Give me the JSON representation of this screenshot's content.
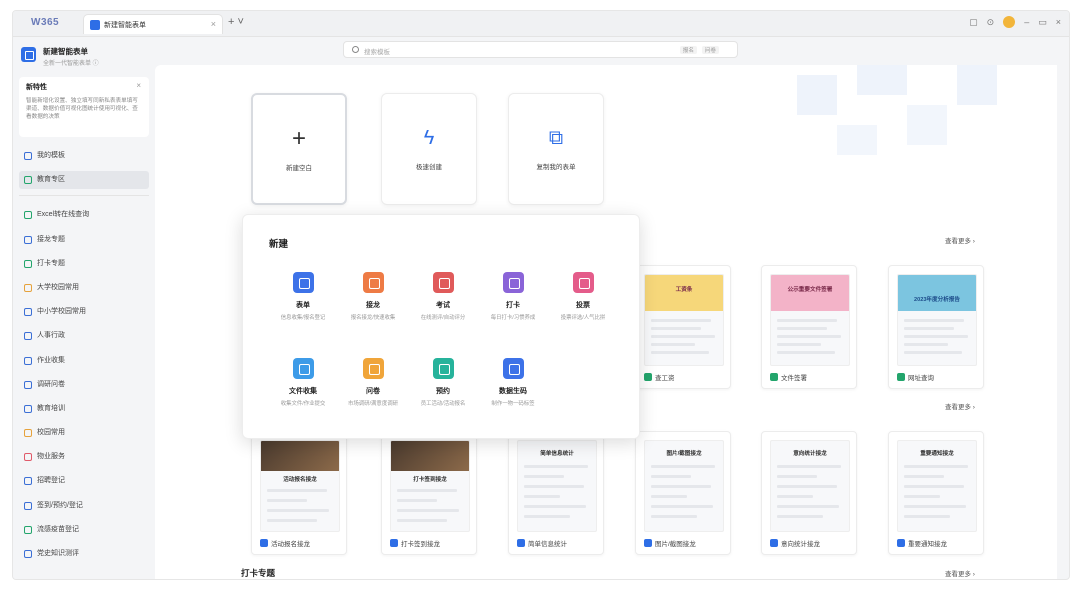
{
  "tabbar": {
    "brand": "W365",
    "tab_title": "新建智能表单",
    "tab_close": "×",
    "new_tab": "+ ˅",
    "controls": [
      "▢",
      "⊙",
      "–",
      "▭",
      "×"
    ]
  },
  "sidebar": {
    "app_title": "新建智能表单",
    "app_subtitle": "全新一代智能表单 ⓘ",
    "tip_title": "新特性",
    "tip_close": "×",
    "tip_body": "智能新增化设置、独立填写同新私表表单填写渠道、数据价值可视化图统计使用可视化、查看数据的决策",
    "items": [
      {
        "label": "我的模板",
        "color": "blue",
        "active": false
      },
      {
        "label": "教育专区",
        "color": "green",
        "active": true
      },
      {
        "label": "Excel转在线查询",
        "color": "green",
        "active": false
      },
      {
        "label": "接龙专题",
        "color": "blue",
        "active": false
      },
      {
        "label": "打卡专题",
        "color": "green",
        "active": false
      },
      {
        "label": "大学校园常用",
        "color": "orange",
        "active": false
      },
      {
        "label": "中小学校园常用",
        "color": "blue",
        "active": false
      },
      {
        "label": "人事行政",
        "color": "blue",
        "active": false
      },
      {
        "label": "作业收集",
        "color": "blue",
        "active": false
      },
      {
        "label": "调研问卷",
        "color": "blue",
        "active": false
      },
      {
        "label": "教育培训",
        "color": "blue",
        "active": false
      },
      {
        "label": "校园常用",
        "color": "orange",
        "active": false
      },
      {
        "label": "物业服务",
        "color": "red",
        "active": false
      },
      {
        "label": "招聘登记",
        "color": "blue",
        "active": false
      },
      {
        "label": "签到/预约/登记",
        "color": "blue",
        "active": false
      },
      {
        "label": "流感疫苗登记",
        "color": "green",
        "active": false
      },
      {
        "label": "党史知识测评",
        "color": "blue",
        "active": false
      }
    ]
  },
  "search": {
    "placeholder": "搜索模板",
    "tag1": "报名",
    "tag2": "问卷"
  },
  "create_cards": [
    {
      "label": "新建空白",
      "icon": "plus-icon",
      "glyph": "+"
    },
    {
      "label": "极速创建",
      "icon": "lightning-icon",
      "glyph": "ϟ"
    },
    {
      "label": "复制我的表单",
      "icon": "copy-icon",
      "glyph": "⧉"
    }
  ],
  "popup": {
    "title": "新建",
    "items": [
      {
        "label": "表单",
        "desc": "信息收集/报名登记",
        "color": "#3d72e8"
      },
      {
        "label": "接龙",
        "desc": "报名接龙/快速收集",
        "color": "#ee7b45"
      },
      {
        "label": "考试",
        "desc": "在线测评/自动评分",
        "color": "#e05a5a"
      },
      {
        "label": "打卡",
        "desc": "每日打卡/习惯养成",
        "color": "#8a64d8"
      },
      {
        "label": "投票",
        "desc": "投票评选/人气比拼",
        "color": "#e45c8a"
      },
      {
        "label": "文件收集",
        "desc": "收集文件/作业提交",
        "color": "#3d9be8"
      },
      {
        "label": "问卷",
        "desc": "市场调研/满意度调研",
        "color": "#f0a53a"
      },
      {
        "label": "预约",
        "desc": "员工活动/活动报名",
        "color": "#26b39b"
      },
      {
        "label": "数据生码",
        "desc": "制作一物一码标签",
        "color": "#3d72e8"
      }
    ]
  },
  "row1": {
    "more": "查看更多 ›",
    "templates": [
      {
        "label": "查工资",
        "header": "工资条",
        "header_color": "#f6d77a"
      },
      {
        "label": "文件签署",
        "header": "公示重要文件签署",
        "header_color": "#f3b3c8"
      },
      {
        "label": "网址查询",
        "header": "2023年度分析报告",
        "header_color": "#7cc5e0"
      }
    ]
  },
  "row2": {
    "more": "查看更多 ›",
    "templates": [
      {
        "label": "活动报名接龙",
        "title": "活动报名接龙",
        "kind": "photo"
      },
      {
        "label": "打卡签到接龙",
        "title": "打卡签到接龙",
        "kind": "photo"
      },
      {
        "label": "简单信息统计",
        "title": "简单信息统计",
        "kind": "form"
      },
      {
        "label": "图片/截图接龙",
        "title": "图片/截图接龙",
        "kind": "form"
      },
      {
        "label": "意向统计接龙",
        "title": "意向统计接龙",
        "kind": "form"
      },
      {
        "label": "重要通知接龙",
        "title": "重要通知接龙",
        "kind": "form"
      }
    ]
  },
  "row3": {
    "title": "打卡专题",
    "more": "查看更多 ›"
  }
}
